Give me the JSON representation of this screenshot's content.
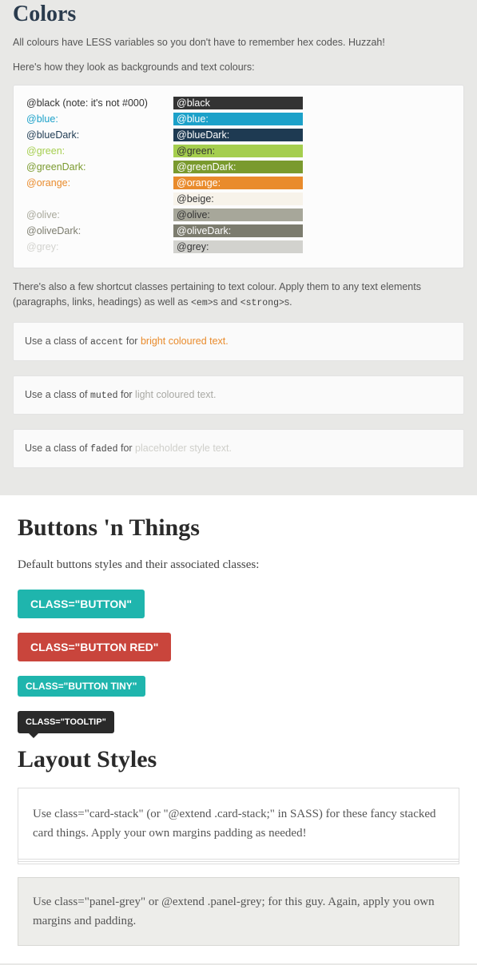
{
  "colors_section": {
    "heading": "Colors",
    "intro1": "All colours have LESS variables so you don't have to remember hex codes. Huzzah!",
    "intro2": "Here's how they look as backgrounds and text colours:",
    "rows": [
      {
        "label": "@black (note: it's not #000)",
        "swatch": "@black",
        "labelColor": "#333333",
        "bg": "#333333",
        "fg": "#ffffff"
      },
      {
        "label": "@blue:",
        "swatch": "@blue:",
        "labelColor": "#1ca1c9",
        "bg": "#1ca1c9",
        "fg": "#ffffff"
      },
      {
        "label": "@blueDark:",
        "swatch": "@blueDark:",
        "labelColor": "#1e3a52",
        "bg": "#1e3a52",
        "fg": "#ffffff"
      },
      {
        "label": "@green:",
        "swatch": "@green:",
        "labelColor": "#a5ce4e",
        "bg": "#a5ce4e",
        "fg": "#333333"
      },
      {
        "label": "@greenDark:",
        "swatch": "@greenDark:",
        "labelColor": "#7a9a2e",
        "bg": "#7a9a2e",
        "fg": "#ffffff"
      },
      {
        "label": "@orange:",
        "swatch": "@orange:",
        "labelColor": "#e98b2c",
        "bg": "#e98b2c",
        "fg": "#ffffff"
      },
      {
        "label": "",
        "swatch": "@beige:",
        "labelColor": "#f7f3ea",
        "bg": "#f7f3ea",
        "fg": "#333333"
      },
      {
        "label": "@olive:",
        "swatch": "@olive:",
        "labelColor": "#a7a79a",
        "bg": "#a7a79a",
        "fg": "#333333"
      },
      {
        "label": "@oliveDark:",
        "swatch": "@oliveDark:",
        "labelColor": "#7c7c6e",
        "bg": "#7c7c6e",
        "fg": "#ffffff"
      },
      {
        "label": "@grey:",
        "swatch": "@grey:",
        "labelColor": "#d2d2ce",
        "bg": "#d2d2ce",
        "fg": "#333333"
      }
    ],
    "desc_parts": {
      "p1": "There's also a few shortcut classes pertaining to text colour. Apply them to any text elements (paragraphs, links, headings) as well as ",
      "c1": "<em>",
      "p2": "s and ",
      "c2": "<strong>",
      "p3": "s."
    },
    "examples": [
      {
        "pre": "Use a class of ",
        "cls": "accent",
        "mid": " for ",
        "demo": "bright coloured text.",
        "demoColor": "#e98b2c"
      },
      {
        "pre": "Use a class of ",
        "cls": "muted",
        "mid": " for ",
        "demo": "light coloured text.",
        "demoColor": "#a9a9a4"
      },
      {
        "pre": "Use a class of ",
        "cls": "faded",
        "mid": " for ",
        "demo": "placeholder style text.",
        "demoColor": "#cfcfca"
      }
    ]
  },
  "buttons_section": {
    "heading": "Buttons 'n Things",
    "intro": "Default buttons styles and their associated classes:",
    "btn1": "CLASS=\"BUTTON\"",
    "btn2": "CLASS=\"BUTTON RED\"",
    "btn3": "CLASS=\"BUTTON TINY\"",
    "tooltip": "CLASS=\"TOOLTIP\""
  },
  "layout_section": {
    "heading": "Layout Styles",
    "card_text": "Use class=\"card-stack\" (or \"@extend .card-stack;\" in SASS) for these fancy stacked card things. Apply your own margins padding as needed!",
    "panel_text": "Use class=\"panel-grey\" or @extend .panel-grey; for this guy. Again, apply you own margins and padding."
  }
}
